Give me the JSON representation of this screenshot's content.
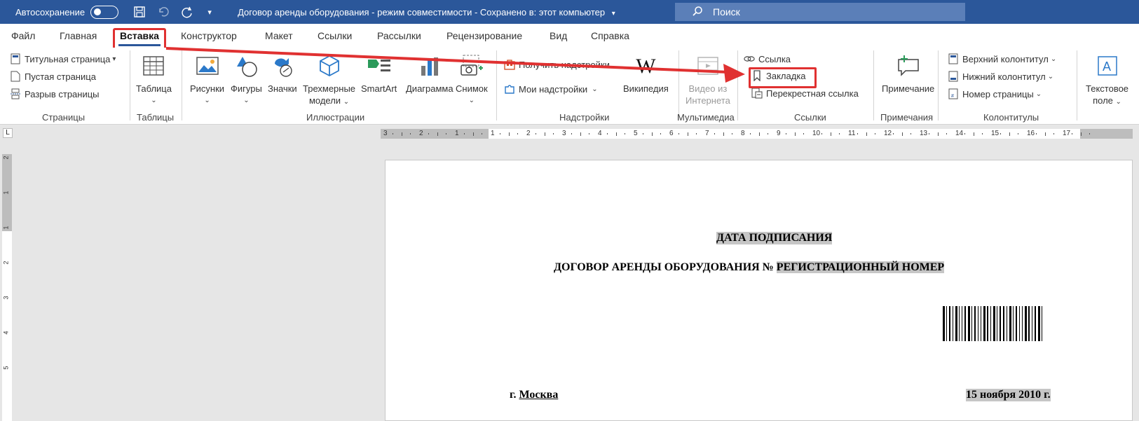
{
  "titlebar": {
    "autosave_label": "Автосохранение",
    "document_title": "Договор аренды оборудования  -  режим совместимости  -  Сохранено в: этот компьютер",
    "search_placeholder": "Поиск"
  },
  "tabs": [
    {
      "label": "Файл"
    },
    {
      "label": "Главная"
    },
    {
      "label": "Вставка"
    },
    {
      "label": "Конструктор"
    },
    {
      "label": "Макет"
    },
    {
      "label": "Ссылки"
    },
    {
      "label": "Рассылки"
    },
    {
      "label": "Рецензирование"
    },
    {
      "label": "Вид"
    },
    {
      "label": "Справка"
    }
  ],
  "ribbon": {
    "pages": {
      "title_page": "Титульная страница",
      "blank_page": "Пустая страница",
      "page_break": "Разрыв страницы",
      "group": "Страницы"
    },
    "tables": {
      "table": "Таблица",
      "group": "Таблицы"
    },
    "illustrations": {
      "pictures": "Рисунки",
      "shapes": "Фигуры",
      "icons": "Значки",
      "models_line1": "Трехмерные",
      "models_line2": "модели",
      "smartart": "SmartArt",
      "chart": "Диаграмма",
      "screenshot": "Снимок",
      "group": "Иллюстрации"
    },
    "addins": {
      "get_addins": "Получить надстройки",
      "my_addins": "Мои надстройки",
      "wikipedia": "Википедия",
      "group": "Надстройки"
    },
    "media": {
      "video_line1": "Видео из",
      "video_line2": "Интернета",
      "group": "Мультимедиа"
    },
    "links": {
      "link": "Ссылка",
      "bookmark": "Закладка",
      "cross_ref": "Перекрестная ссылка",
      "group": "Ссылки"
    },
    "comments": {
      "comment": "Примечание",
      "group": "Примечания"
    },
    "header_footer": {
      "header": "Верхний колонтитул",
      "footer": "Нижний колонтитул",
      "page_number": "Номер страницы",
      "group": "Колонтитулы"
    },
    "text": {
      "textbox_line1": "Текстовое",
      "textbox_line2": "поле"
    }
  },
  "ruler": {
    "h_labels": [
      "3",
      "2",
      "1",
      "1",
      "2",
      "3",
      "4",
      "5",
      "6",
      "7",
      "8",
      "9",
      "10",
      "11",
      "12",
      "13",
      "14",
      "15",
      "16",
      "17"
    ],
    "v_labels": [
      "2",
      "1",
      "1",
      "2",
      "3",
      "4",
      "5"
    ]
  },
  "document": {
    "signing_date": "ДАТА ПОДПИСАНИЯ",
    "contract_title_prefix": "ДОГОВОР АРЕНДЫ ОБОРУДОВАНИЯ № ",
    "contract_number": "РЕГИСТРАЦИОННЫЙ НОМЕР",
    "city_prefix": "г. ",
    "city": "Москва",
    "date": "15 ноября 2010 г."
  },
  "colors": {
    "accent": "#2b579a",
    "highlight": "#e03131",
    "field_shading": "#c6c6c6"
  }
}
